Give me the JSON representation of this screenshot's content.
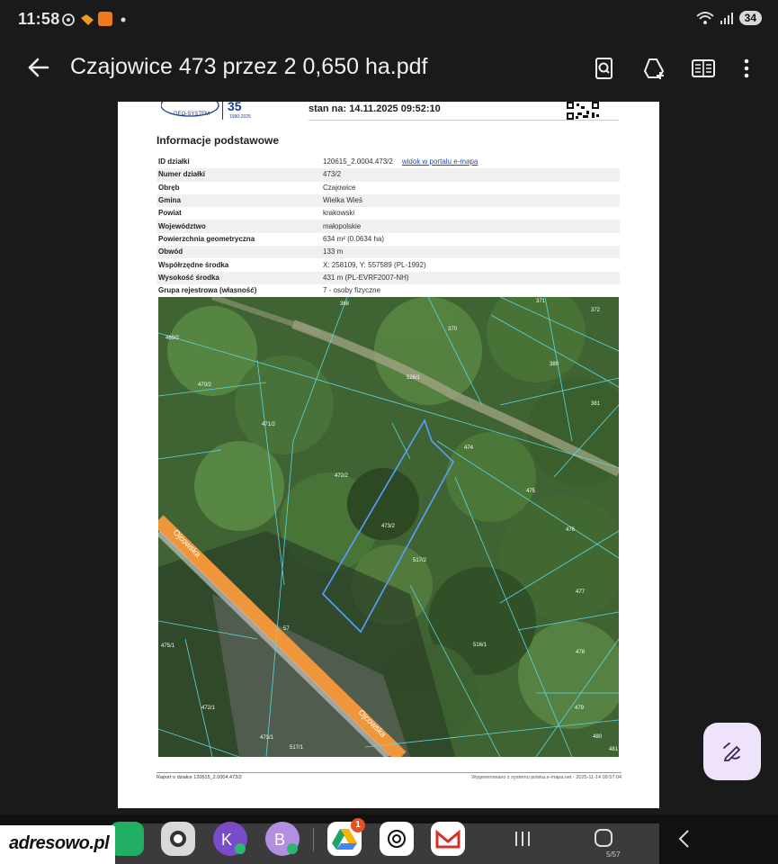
{
  "status_bar": {
    "time": "11:58",
    "battery": "34"
  },
  "toolbar": {
    "title": "Czajowice 473 przez 2  0,650 ha.pdf"
  },
  "document": {
    "header_date": "stan na: 14.11.2025 09:52:10",
    "logo_text": "GEO-SYSTEM",
    "logo_years": "1990-2025",
    "section_title": "Informacje podstawowe",
    "rows": [
      {
        "label": "ID działki",
        "value": "120615_2.0004.473/2",
        "link": "widok w portalu e-mapa"
      },
      {
        "label": "Numer działki",
        "value": "473/2"
      },
      {
        "label": "Obręb",
        "value": "Czajowice"
      },
      {
        "label": "Gmina",
        "value": "Wielka Wieś"
      },
      {
        "label": "Powiat",
        "value": "krakowski"
      },
      {
        "label": "Województwo",
        "value": "małopolskie"
      },
      {
        "label": "Powierzchnia geometryczna",
        "value": "634 m² (0.0634 ha)"
      },
      {
        "label": "Obwód",
        "value": "133 m"
      },
      {
        "label": "Współrzędne środka",
        "value": "X: 258109, Y: 557589 (PL-1992)"
      },
      {
        "label": "Wysokość środka",
        "value": "431 m (PL-EVRF2007-NH)"
      },
      {
        "label": "Grupa rejestrowa (własność)",
        "value": "7 - osoby fizyczne"
      }
    ],
    "map_labels": {
      "road_top": "Ojcowska",
      "road_bottom": "Ojcowska",
      "parcels": [
        "368",
        "371",
        "372",
        "370",
        "469/2",
        "380",
        "470/2",
        "526/1",
        "381",
        "471/2",
        "474",
        "472/2",
        "475",
        "476",
        "473/2",
        "517/2",
        "477",
        "57",
        "475/1",
        "516/1",
        "478",
        "472/1",
        "479",
        "473/1",
        "517/1",
        "480",
        "481"
      ]
    },
    "footer_left": "Raport o działce 120615_2.0004.473/2",
    "footer_right": "Wygenerowano z systemu polska.e-mapa.net - 2025-11-14 09:57:04"
  },
  "dock": {
    "notification_count": "1",
    "page_indicator": "5/57"
  },
  "watermark": "adresowo.pl",
  "colors": {
    "background": "#1a1a1a",
    "fab": "#efe2fb",
    "road": "#f0963a",
    "parcel_line": "#5fd6e0",
    "selected_parcel": "#5aa0ff"
  }
}
